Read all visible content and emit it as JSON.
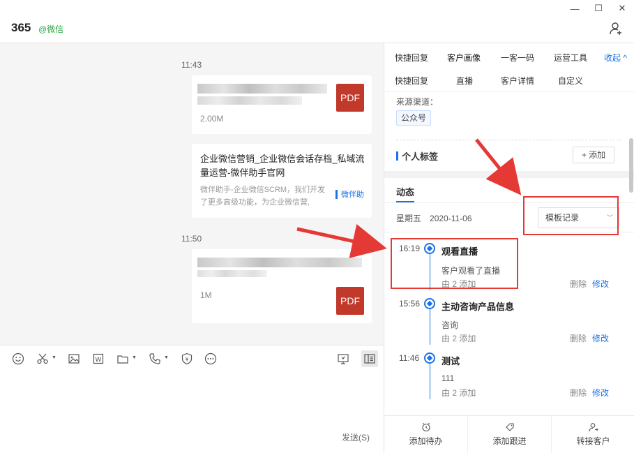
{
  "window": {
    "minimize": "—",
    "maximize": "☐",
    "close": "✕"
  },
  "header": {
    "name": "365",
    "tag": "@微信"
  },
  "chat": {
    "messages": [
      {
        "time": "11:43",
        "type": "file",
        "size": "2.00M",
        "badge": "PDF"
      },
      {
        "type": "link",
        "title": "企业微信营销_企业微信会话存档_私域流量运营-微伴助手官网",
        "desc": "微伴助手-企业微信SCRM，我们开发了更多高级功能，为企业微信营,",
        "brand": "微伴助"
      },
      {
        "time": "11:50",
        "type": "file",
        "size": "1M",
        "badge": "PDF"
      }
    ],
    "send_label": "发送(S)"
  },
  "panel": {
    "tabs_primary": [
      "快捷回复",
      "客户画像",
      "一客一码",
      "运营工具"
    ],
    "collapse_label": "收起 ^",
    "tabs_secondary": [
      "快捷回复",
      "直播",
      "客户详情",
      "自定义"
    ],
    "source_label": "来源渠道：",
    "source_value": "公众号",
    "personal_tag_title": "个人标签",
    "add_label": "+ 添加",
    "dynamics_title": "动态",
    "date_weekday": "星期五",
    "date_value": "2020-11-06",
    "filter_value": "模板记录",
    "timeline": [
      {
        "time": "16:19",
        "title": "观看直播",
        "desc": "客户观看了直播",
        "by": "由 2 添加",
        "delete": "删除",
        "edit": "修改"
      },
      {
        "time": "15:56",
        "title": "主动咨询产品信息",
        "desc": "咨询",
        "by": "由 2 添加",
        "delete": "删除",
        "edit": "修改"
      },
      {
        "time": "11:46",
        "title": "测试",
        "desc": "111",
        "by": "由 2 添加",
        "delete": "删除",
        "edit": "修改"
      }
    ],
    "bottom_actions": [
      "添加待办",
      "添加跟进",
      "转接客户"
    ]
  },
  "colors": {
    "accent": "#1a73e8",
    "pdf": "#c0392b",
    "annotation": "#e53935",
    "tag_green": "#28a745"
  }
}
